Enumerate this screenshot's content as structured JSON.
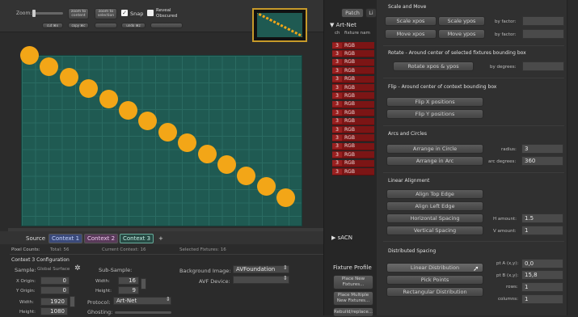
{
  "toolbar": {
    "zoom_label": "Zoom:",
    "zoom_to_content": "zoom to content",
    "zoom_to_selection": "zoom to selection",
    "snap_label": "Snap",
    "reveal_obscured_label": "Reveal Obscured",
    "row2": [
      "cut ⌘x",
      "copy ⌘c",
      "",
      "undo ⌘z",
      ""
    ]
  },
  "dot_count": 14,
  "context_tabs": [
    "Source",
    "Context 1",
    "Context 2",
    "Context 3",
    "+"
  ],
  "stats": {
    "pixel_counts_label": "Pixel Counts:",
    "total": "Total: 56",
    "current": "Current Context: 16",
    "selected": "Selected Fixtures: 16"
  },
  "config": {
    "title": "Context 3 Configuration",
    "sample_label": "Sample:",
    "sample_value": "Global Surface",
    "subsample_label": "Sub-Sample:",
    "x_origin_label": "X Origin:",
    "x_origin": "0",
    "y_origin_label": "Y Origin:",
    "y_origin": "0",
    "width_label": "Width:",
    "width": "1920",
    "height_label": "Height:",
    "height": "1080",
    "sub_width_label": "Width:",
    "sub_width": "16",
    "sub_height_label": "Height:",
    "sub_height": "9",
    "protocol_label": "Protocol:",
    "protocol": "Art-Net",
    "ghosting_label": "Ghosting:",
    "bg_label": "Background Image:",
    "bg_value": "AVFoundation",
    "avf_label": "AVF Device:",
    "avf_value": ""
  },
  "middle": {
    "tab_patch": "Patch",
    "tab_other": "Li",
    "artnet_label": "▼ Art-Net",
    "col_ch": "ch",
    "col_fixture": "fixture nam",
    "rows": [
      "RGB",
      "RGB",
      "RGB",
      "RGB",
      "RGB",
      "RGB",
      "RGB",
      "RGB",
      "RGB",
      "RGB",
      "RGB",
      "RGB",
      "RGB",
      "RGB",
      "RGB",
      "RGB"
    ],
    "row_ch": "3",
    "sacn_label": "▶ sACN",
    "fixture_profile": "Fixture Profile",
    "place_new": "Place New Fixtures...",
    "place_multiple": "Place Multiple New Fixtures...",
    "rebuild": "Rebuild/replace..."
  },
  "right": {
    "scale_title": "Scale and Move",
    "scale_xpos": "Scale xpos",
    "scale_ypos": "Scale ypos",
    "by_factor_1": "by factor:",
    "move_xpos": "Move xpos",
    "move_ypos": "Move ypos",
    "by_factor_2": "by factor:",
    "rotate_title": "Rotate - Around center of selected fixtures bounding box",
    "rotate_btn": "Rotate xpos & ypos",
    "by_degrees": "by degrees:",
    "flip_title": "Flip - Around center of context bounding box",
    "flip_x": "Flip X positions",
    "flip_y": "Flip Y positions",
    "arcs_title": "Arcs and Circles",
    "arrange_circle": "Arrange in Circle",
    "radius_label": "radius:",
    "radius": "3",
    "arrange_arc": "Arrange in Arc",
    "arc_deg_label": "arc degrees:",
    "arc_deg": "360",
    "linear_title": "Linear Alignment",
    "align_top": "Align Top Edge",
    "align_left": "Align Left Edge",
    "h_spacing": "Horizontal Spacing",
    "h_amount_label": "H amount:",
    "h_amount": "1.5",
    "v_spacing": "Vertical Spacing",
    "v_amount_label": "V amount:",
    "v_amount": "1",
    "dist_title": "Distributed Spacing",
    "linear_dist": "Linear Distribution",
    "pta_label": "pt A (x,y):",
    "pta": "0,0",
    "pick_points": "Pick Points",
    "ptb_label": "pt B (x,y):",
    "ptb": "15,8",
    "rect_dist": "Rectangular Distribution",
    "rows_label": "rows:",
    "rows": "1",
    "columns_label": "columns:",
    "columns": "1"
  }
}
